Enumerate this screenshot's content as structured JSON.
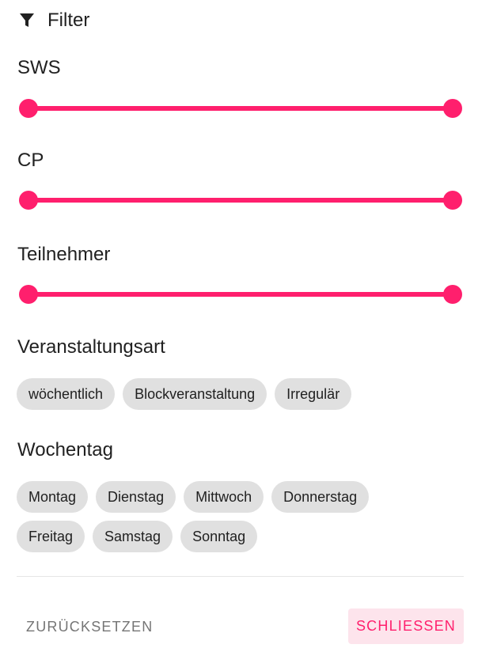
{
  "header": {
    "title": "Filter",
    "icon": "filter-icon"
  },
  "colors": {
    "accent": "#ff1f6d",
    "chip_bg": "#e0e0e0",
    "close_bg": "#fde4ec"
  },
  "sliders": [
    {
      "label": "SWS",
      "range_fraction": [
        0,
        1
      ]
    },
    {
      "label": "CP",
      "range_fraction": [
        0,
        1
      ]
    },
    {
      "label": "Teilnehmer",
      "range_fraction": [
        0,
        1
      ]
    }
  ],
  "veranstaltungsart": {
    "label": "Veranstaltungsart",
    "chips": [
      "wöchentlich",
      "Blockveranstaltung",
      "Irregulär"
    ]
  },
  "wochentag": {
    "label": "Wochentag",
    "chips_row1": [
      "Montag",
      "Dienstag",
      "Mittwoch",
      "Donnerstag"
    ],
    "chips_row2": [
      "Freitag",
      "Samstag",
      "Sonntag"
    ]
  },
  "actions": {
    "reset_label": "ZURÜCKSETZEN",
    "close_label": "SCHLIESSEN"
  }
}
